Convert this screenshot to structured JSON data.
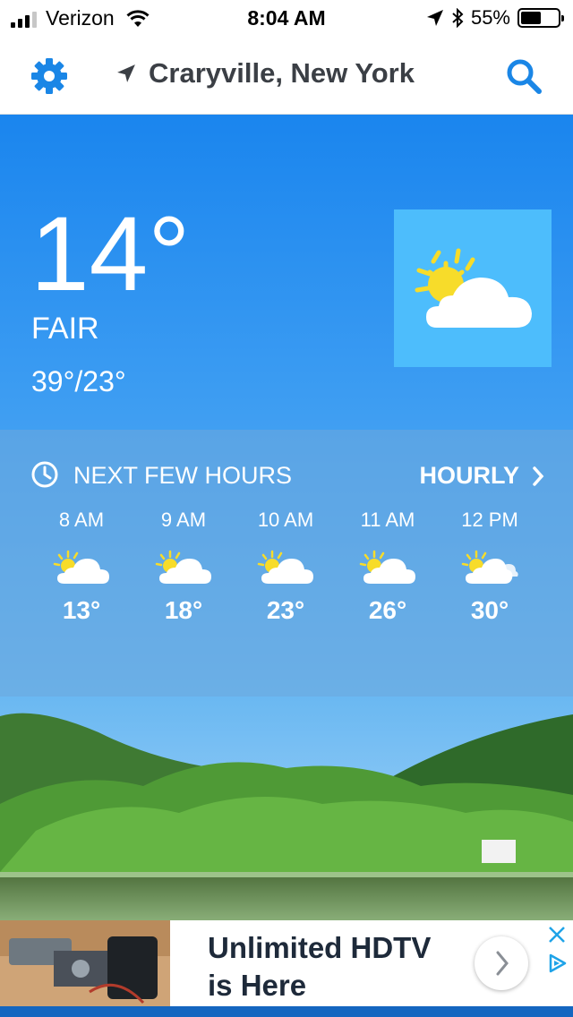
{
  "status_bar": {
    "carrier": "Verizon",
    "time": "8:04 AM",
    "battery": "55%",
    "battery_level": 0.55,
    "icons": [
      "signal-icon",
      "wifi-icon",
      "location-arrow-icon",
      "bluetooth-icon",
      "battery-icon"
    ]
  },
  "header": {
    "location": "Craryville, New York",
    "icons": [
      "gear-icon",
      "location-arrow-icon",
      "search-icon"
    ],
    "accent_color": "#1a86e6"
  },
  "current": {
    "temperature": "14°",
    "condition": "FAIR",
    "hi_lo": "39°/23°",
    "icon": "sun-cloud-icon"
  },
  "hourly": {
    "title": "NEXT FEW HOURS",
    "link_label": "HOURLY",
    "items": [
      {
        "time": "8 AM",
        "temp": "13°",
        "icon": "sun-cloud-icon"
      },
      {
        "time": "9 AM",
        "temp": "18°",
        "icon": "sun-cloud-icon"
      },
      {
        "time": "10 AM",
        "temp": "23°",
        "icon": "sun-cloud-icon"
      },
      {
        "time": "11 AM",
        "temp": "26°",
        "icon": "sun-cloud-icon"
      },
      {
        "time": "12 PM",
        "temp": "30°",
        "icon": "sun-clouds-icon"
      }
    ]
  },
  "ad": {
    "line1": "Unlimited HDTV",
    "line2": "is Here"
  }
}
